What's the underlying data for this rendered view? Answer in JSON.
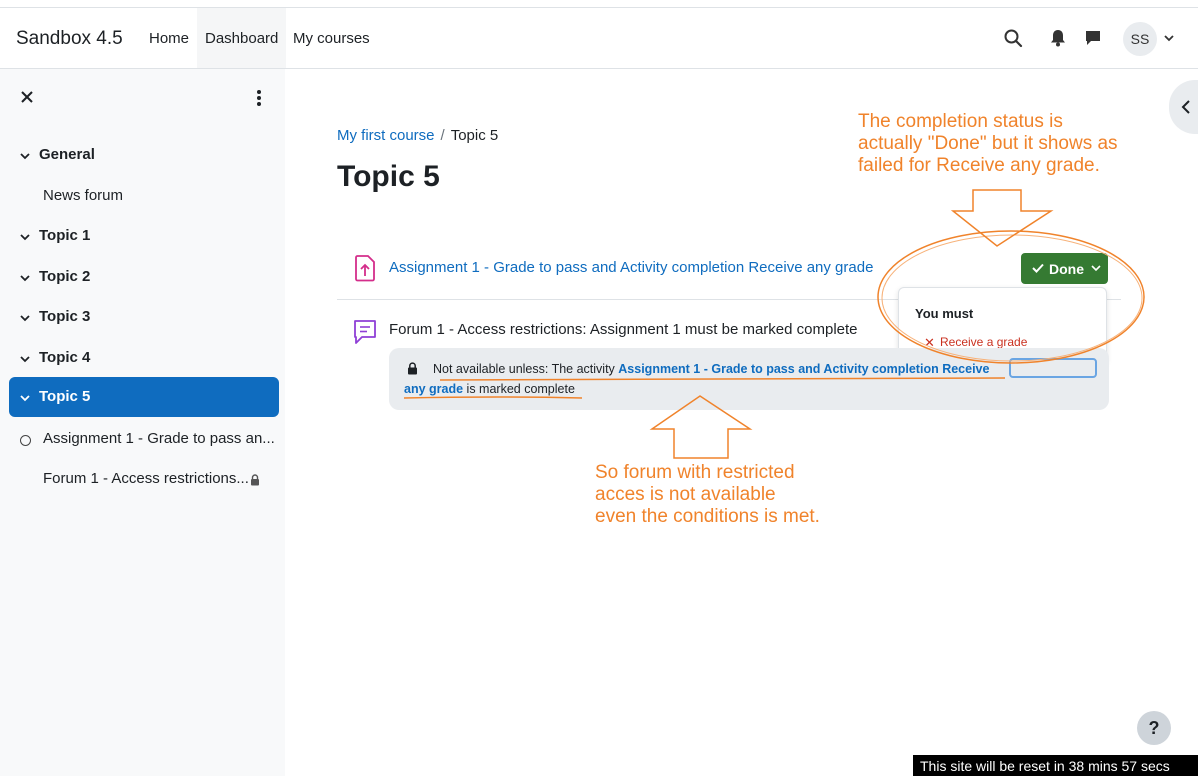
{
  "navbar": {
    "brand": "Sandbox 4.5",
    "links": [
      "Home",
      "Dashboard",
      "My courses"
    ],
    "active_link": "Dashboard",
    "avatar_initials": "SS"
  },
  "drawer": {
    "sections": [
      {
        "label": "General",
        "expanded": true
      },
      {
        "label": "Topic 1",
        "expanded": true
      },
      {
        "label": "Topic 2",
        "expanded": true
      },
      {
        "label": "Topic 3",
        "expanded": true
      },
      {
        "label": "Topic 4",
        "expanded": true
      },
      {
        "label": "Topic 5",
        "expanded": true,
        "active": true
      }
    ],
    "general_items": [
      "News forum"
    ],
    "topic5_items": [
      "Assignment 1 - Grade to pass an...",
      "Forum 1 - Access restrictions..."
    ]
  },
  "breadcrumb": {
    "course": "My first course",
    "current": "Topic 5"
  },
  "page_title": "Topic 5",
  "activities": [
    {
      "title": "Assignment 1 - Grade to pass and Activity completion Receive any grade",
      "icon": "assignment-upload-icon"
    },
    {
      "title": "Forum 1 - Access restrictions: Assignment 1 must be marked complete",
      "icon": "forum-icon"
    }
  ],
  "completion": {
    "button_label": "Done",
    "popover_title": "You must",
    "requirement": "Receive a grade",
    "requirement_status": "failed"
  },
  "restriction": {
    "prefix": "Not available unless: The activity ",
    "activity_link_part1": "Assignment 1 - Grade to pass and Activity completion Receive",
    "activity_link_part2": "any grade",
    "suffix": " is marked complete"
  },
  "annotations": {
    "top_right": [
      "The completion status is",
      "actually \"Done\" but it shows as",
      "failed for Receive any grade."
    ],
    "bottom": [
      "So forum with restricted",
      "acces is not available",
      "even the conditions is met."
    ]
  },
  "help_label": "?",
  "reset_notice": "This site will be reset in 38 mins 57 secs",
  "colors": {
    "primary": "#0f6cbf",
    "success": "#357a32",
    "danger": "#ca3120",
    "annotation": "#f0832b"
  }
}
